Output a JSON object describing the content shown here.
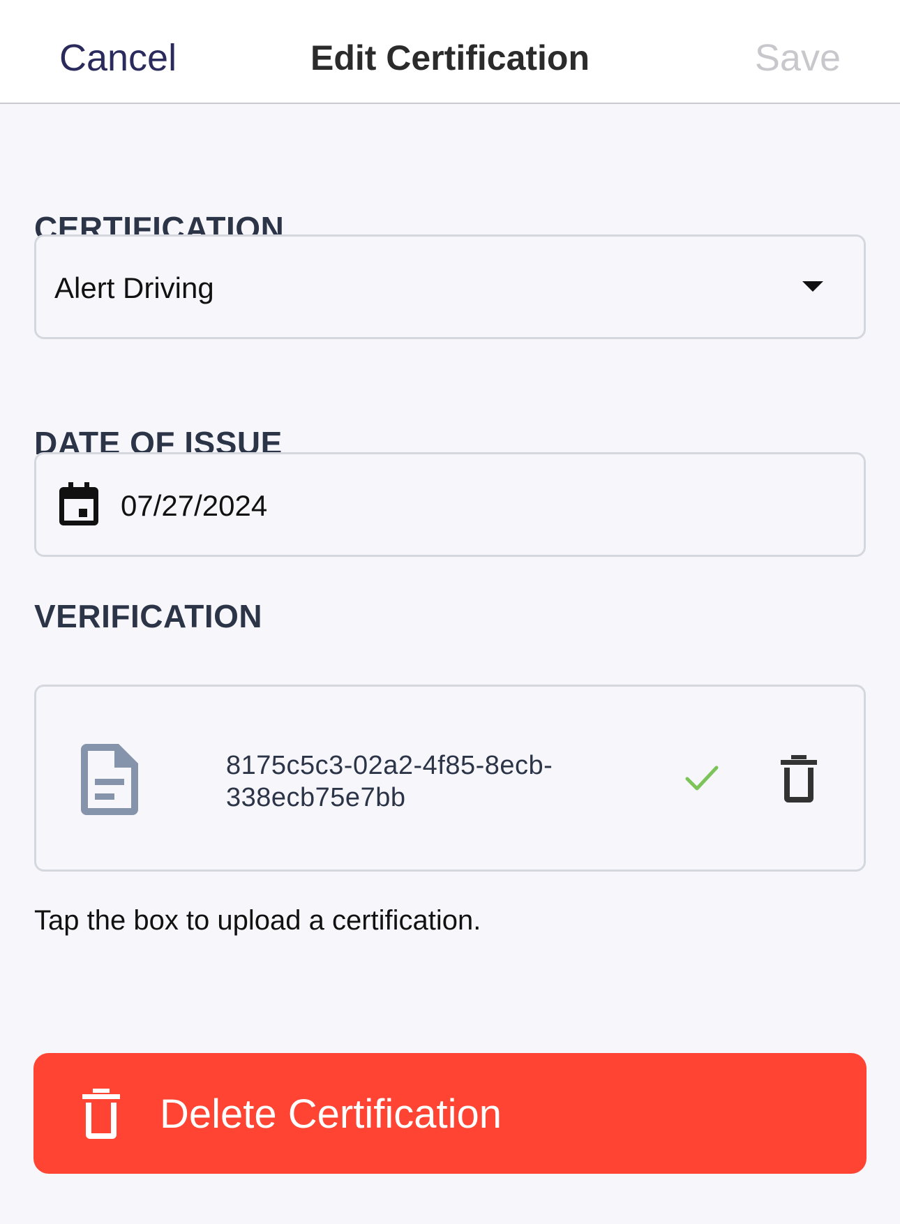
{
  "navbar": {
    "cancel_label": "Cancel",
    "title": "Edit Certification",
    "save_label": "Save"
  },
  "certification": {
    "section_label": "CERTIFICATION",
    "selected_value": "Alert Driving"
  },
  "date_of_issue": {
    "section_label": "DATE OF ISSUE",
    "value": "07/27/2024",
    "icon": "calendar-icon"
  },
  "verification": {
    "section_label": "VERIFICATION",
    "file": {
      "name_line1": "8175c5c3-02a2-4f85-8ecb-",
      "name_line2": "338ecb75e7bb",
      "icon": "document-icon",
      "status_icon": "checkmark-icon",
      "delete_icon": "trash-icon"
    },
    "helper_text": "Tap the box to upload a certification."
  },
  "delete_button": {
    "label": "Delete Certification",
    "icon": "trash-icon"
  },
  "colors": {
    "background": "#f7f7fb",
    "cancel_text": "#2a2a5c",
    "save_disabled": "#c8c8cc",
    "section_label": "#2c3448",
    "field_border": "#d5d7de",
    "check_green": "#7cc45a",
    "destructive": "#ff4433",
    "doc_icon": "#8593ab"
  }
}
